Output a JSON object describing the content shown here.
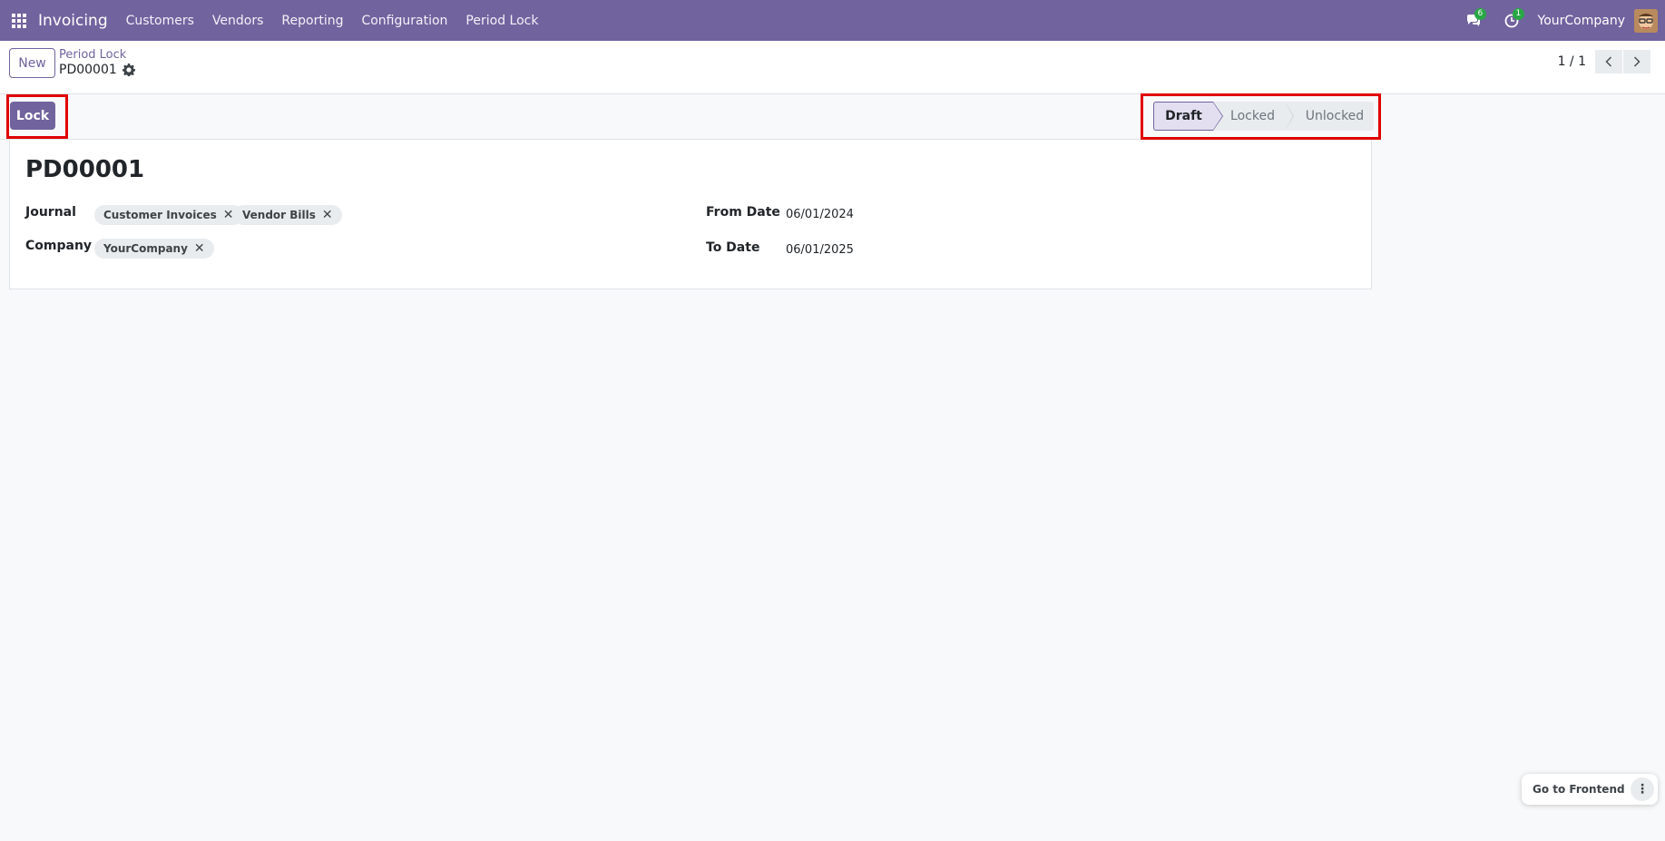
{
  "navbar": {
    "app_name": "Invoicing",
    "menu": [
      "Customers",
      "Vendors",
      "Reporting",
      "Configuration",
      "Period Lock"
    ],
    "messages_count": "6",
    "activities_count": "1",
    "company": "YourCompany",
    "bg_color": "#71639e"
  },
  "control_panel": {
    "new_label": "New",
    "breadcrumb": "Period Lock",
    "record_name": "PD00001",
    "pager": "1 / 1"
  },
  "statusbar": {
    "lock_label": "Lock",
    "steps": [
      "Draft",
      "Locked",
      "Unlocked"
    ],
    "active_step": "Draft"
  },
  "form": {
    "title": "PD00001",
    "journal_label": "Journal",
    "journal_tags": [
      "Customer Invoices",
      "Vendor Bills"
    ],
    "company_label": "Company",
    "company_tags": [
      "YourCompany"
    ],
    "from_date_label": "From Date",
    "from_date": "06/01/2024",
    "to_date_label": "To Date",
    "to_date": "06/01/2025"
  },
  "floating": {
    "go_frontend": "Go to Frontend",
    "more_label": "⋮"
  }
}
